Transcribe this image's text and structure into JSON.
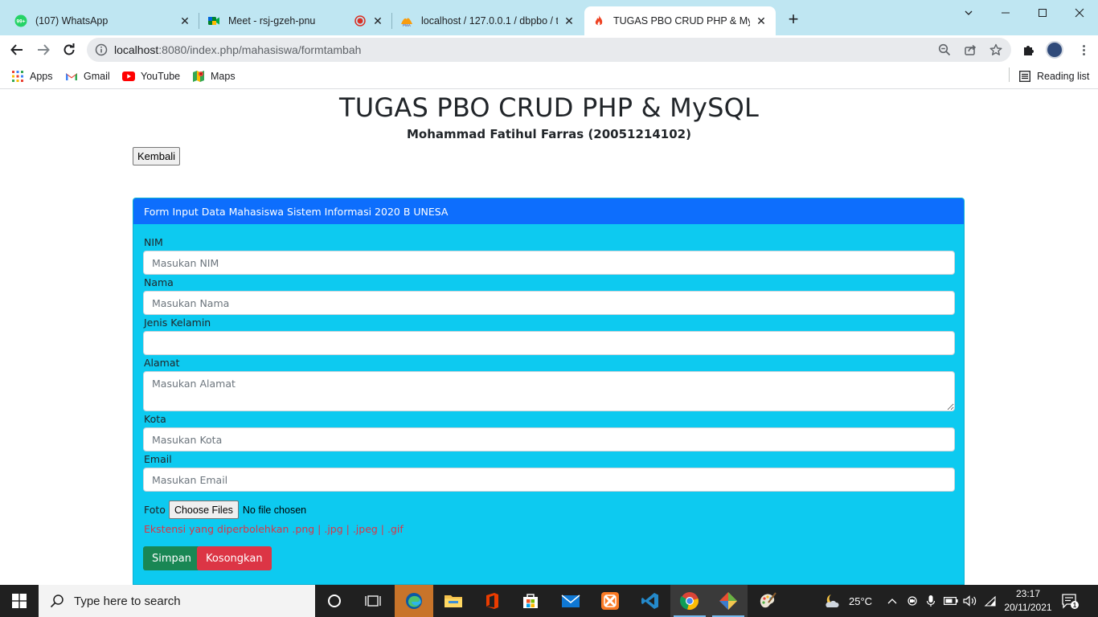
{
  "browser": {
    "tabs": [
      {
        "title": "(107) WhatsApp",
        "icon": "whatsapp-icon",
        "badge": "99+"
      },
      {
        "title": "Meet - rsj-gzeh-pnu",
        "icon": "google-meet-icon",
        "recording": true
      },
      {
        "title": "localhost / 127.0.0.1 / dbpbo / tr",
        "icon": "phpmyadmin-icon"
      },
      {
        "title": "TUGAS PBO CRUD PHP & MySQL",
        "icon": "codeigniter-icon",
        "active": true
      }
    ],
    "url_host": "localhost",
    "url_path": ":8080/index.php/mahasiswa/formtambah",
    "bookmarks": [
      {
        "label": "Apps",
        "icon": "apps-grid-icon"
      },
      {
        "label": "Gmail",
        "icon": "gmail-icon"
      },
      {
        "label": "YouTube",
        "icon": "youtube-icon"
      },
      {
        "label": "Maps",
        "icon": "maps-icon"
      }
    ],
    "reading_list": "Reading list"
  },
  "page": {
    "title": "TUGAS PBO CRUD PHP & MySQL",
    "subtitle": "Mohammad Fatihul Farras (20051214102)",
    "back_button": "Kembali",
    "card_header": "Form Input Data Mahasiswa Sistem Informasi 2020 B UNESA",
    "form": {
      "nim_label": "NIM",
      "nim_placeholder": "Masukan NIM",
      "nama_label": "Nama",
      "nama_placeholder": "Masukan Nama",
      "jk_label": "Jenis Kelamin",
      "jk_value": "",
      "alamat_label": "Alamat",
      "alamat_placeholder": "Masukan Alamat",
      "kota_label": "Kota",
      "kota_placeholder": "Masukan Kota",
      "email_label": "Email",
      "email_placeholder": "Masukan Email",
      "foto_label": "Foto",
      "file_button": "Choose Files",
      "file_status": "No file chosen",
      "ext_note": "Ekstensi yang diperbolehkan .png | .jpg | .jpeg | .gif",
      "save_button": "Simpan",
      "clear_button": "Kosongkan"
    }
  },
  "taskbar": {
    "search_placeholder": "Type here to search",
    "temperature": "25°C",
    "time": "23:17",
    "date": "20/11/2021",
    "notification_count": "1",
    "colors": {
      "bar": "#202020",
      "accent": "#76b9ed"
    }
  },
  "colors": {
    "card_bg": "#0dcaf0",
    "card_header": "#0d6efd",
    "save": "#198754",
    "clear": "#dc3545",
    "tabstrip": "#bfe6f2"
  }
}
